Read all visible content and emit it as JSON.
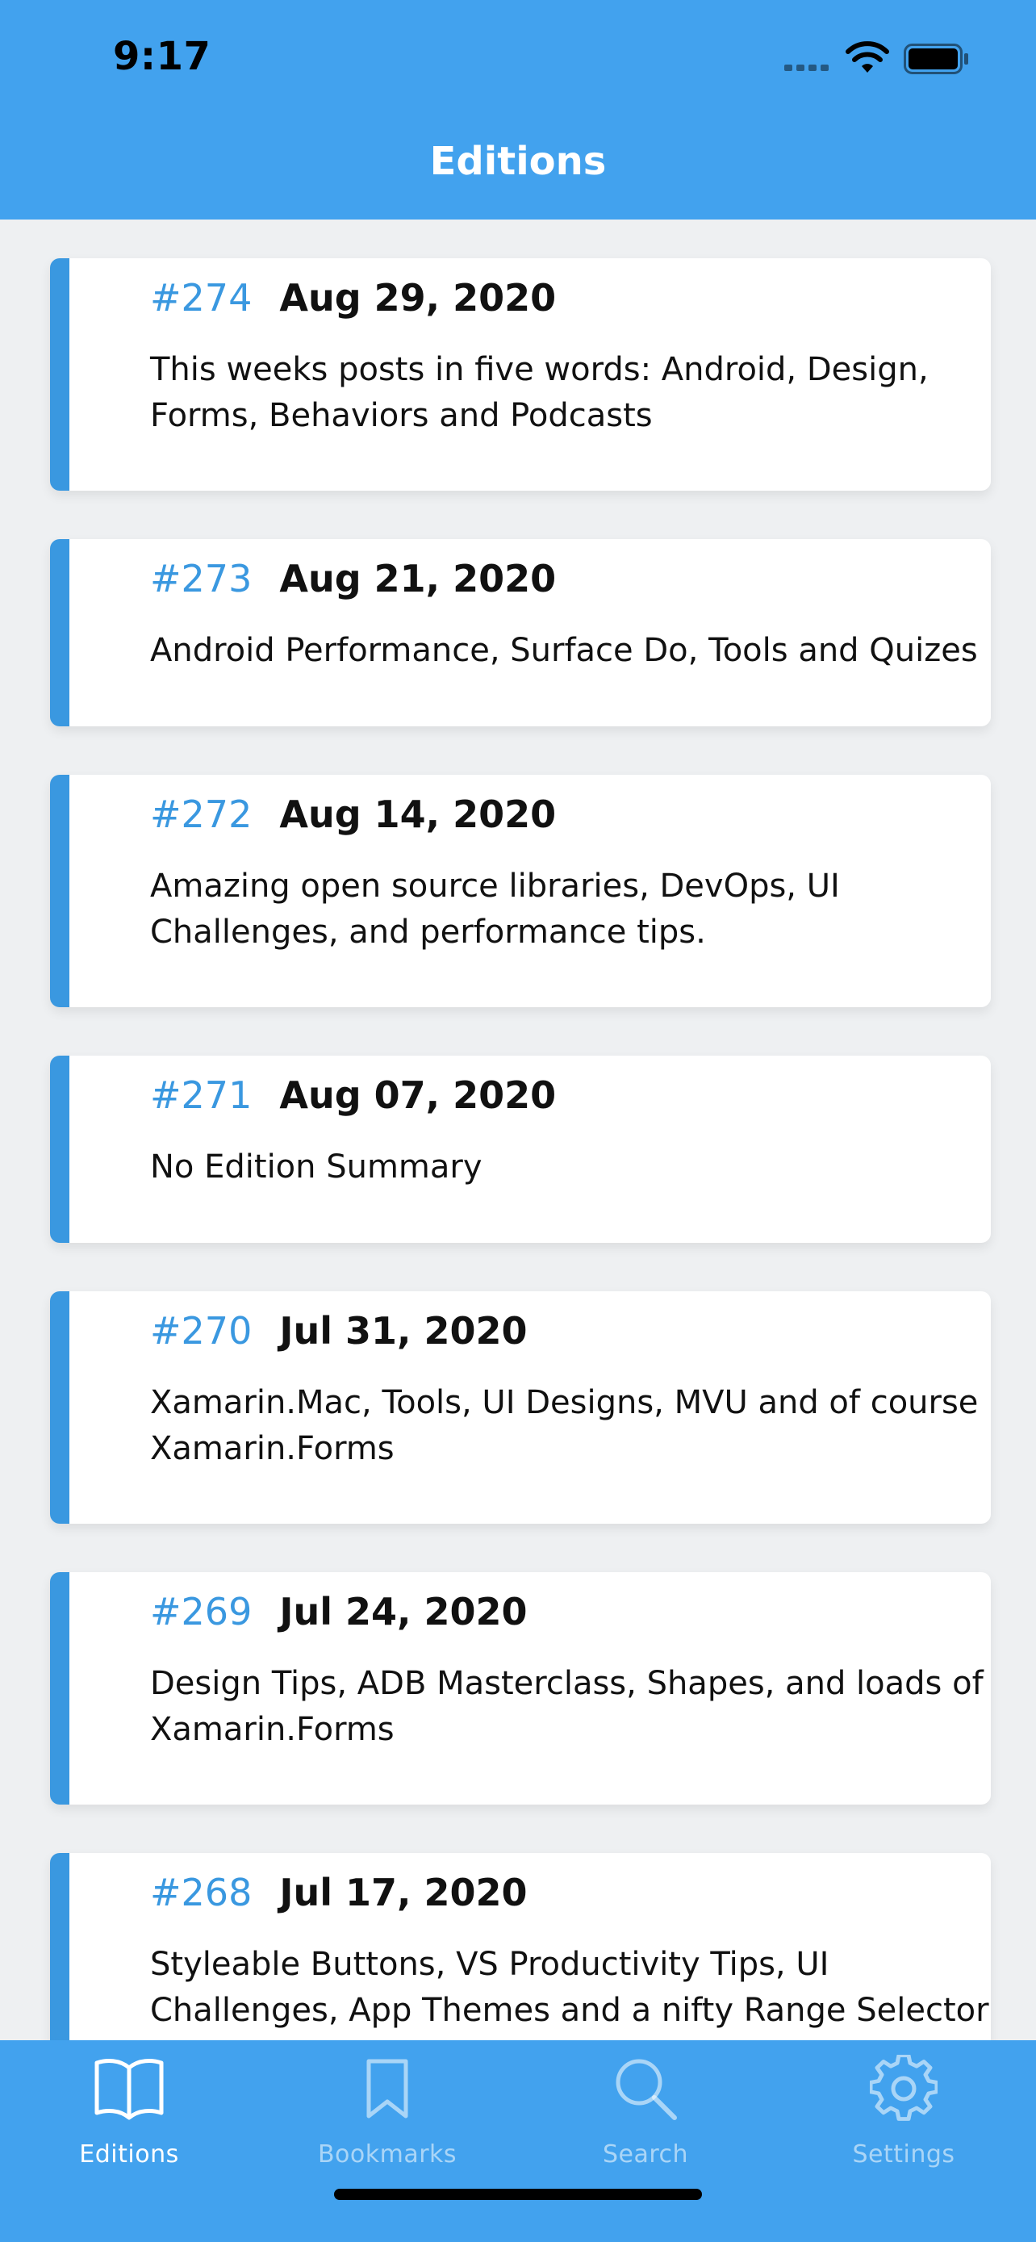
{
  "status": {
    "time": "9:17"
  },
  "header": {
    "title": "Editions"
  },
  "editions": [
    {
      "number": "#274",
      "date": "Aug 29, 2020",
      "summary": "This weeks posts in five words: Android, Design, Forms, Behaviors and Podcasts"
    },
    {
      "number": "#273",
      "date": "Aug 21, 2020",
      "summary": "Android Performance, Surface Do, Tools and Quizes"
    },
    {
      "number": "#272",
      "date": "Aug 14, 2020",
      "summary": "Amazing open source libraries, DevOps, UI Challenges, and performance tips."
    },
    {
      "number": "#271",
      "date": "Aug 07, 2020",
      "summary": "No Edition Summary"
    },
    {
      "number": "#270",
      "date": "Jul 31, 2020",
      "summary": "Xamarin.Mac, Tools, UI Designs, MVU and of course Xamarin.Forms"
    },
    {
      "number": "#269",
      "date": "Jul 24, 2020",
      "summary": "Design Tips, ADB Masterclass, Shapes, and loads of Xamarin.Forms"
    },
    {
      "number": "#268",
      "date": "Jul 17, 2020",
      "summary": "Styleable Buttons, VS Productivity Tips, UI Challenges, App Themes and a nifty Range Selector control. So"
    }
  ],
  "tabs": [
    {
      "label": "Editions",
      "icon": "book-icon",
      "active": true
    },
    {
      "label": "Bookmarks",
      "icon": "bookmark-icon",
      "active": false
    },
    {
      "label": "Search",
      "icon": "search-icon",
      "active": false
    },
    {
      "label": "Settings",
      "icon": "gear-icon",
      "active": false
    }
  ],
  "colors": {
    "primary": "#42a2ee",
    "accent": "#3a98e0",
    "background": "#eef0f2"
  }
}
